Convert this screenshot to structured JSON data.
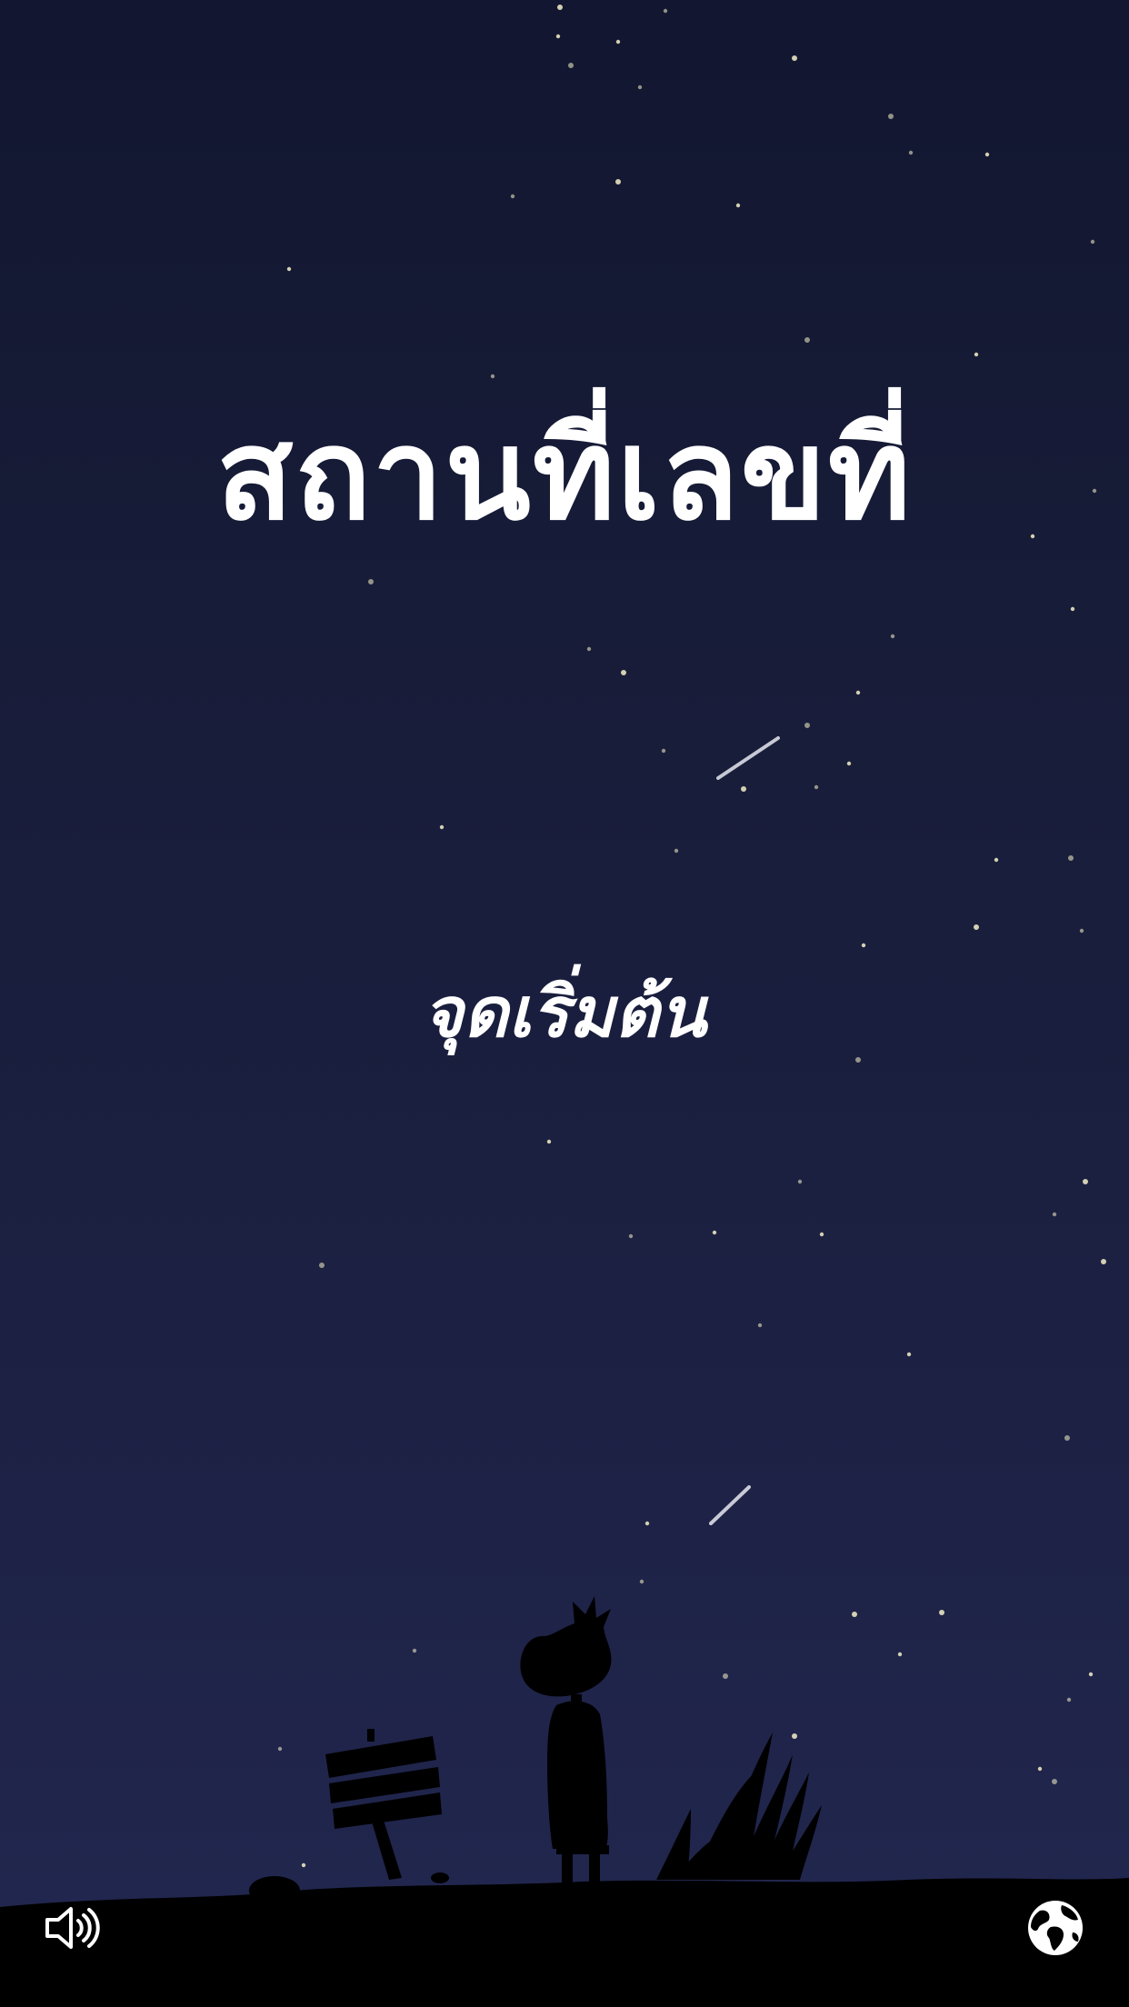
{
  "screen": {
    "title": "สถานที่เลขที่",
    "start_label": "จุดเริ่มต้น"
  },
  "controls": {
    "sound_icon": "speaker-volume-icon",
    "language_icon": "globe-icon"
  },
  "colors": {
    "sky_top": "#121630",
    "sky_bottom": "#222750",
    "star": "#e8e4c0",
    "silhouette": "#000000",
    "text": "#ffffff"
  }
}
